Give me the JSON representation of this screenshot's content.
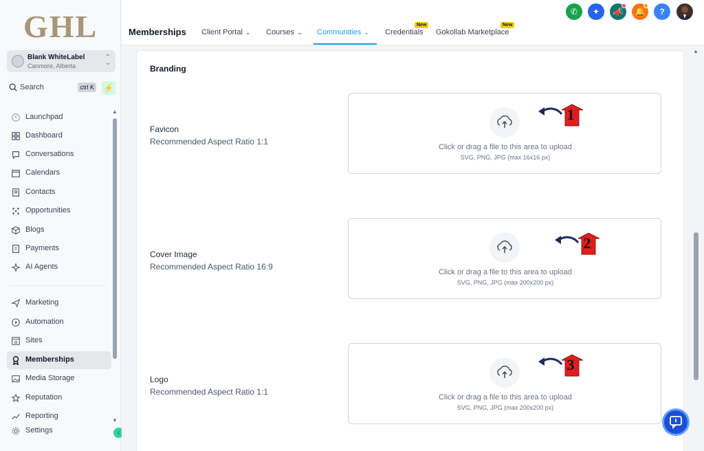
{
  "logo_text": "GHL",
  "account": {
    "name": "Blank WhiteLabel",
    "location": "Canmore, Alberta"
  },
  "search": {
    "label": "Search",
    "shortcut": "ctrl K"
  },
  "sidebar": {
    "items": [
      {
        "label": "Launchpad",
        "icon": "rocket-icon"
      },
      {
        "label": "Dashboard",
        "icon": "grid-icon"
      },
      {
        "label": "Conversations",
        "icon": "chat-icon"
      },
      {
        "label": "Calendars",
        "icon": "calendar-icon"
      },
      {
        "label": "Contacts",
        "icon": "contacts-icon"
      },
      {
        "label": "Opportunities",
        "icon": "opportunities-icon"
      },
      {
        "label": "Blogs",
        "icon": "cube-icon"
      },
      {
        "label": "Payments",
        "icon": "receipt-icon"
      },
      {
        "label": "AI Agents",
        "icon": "sparkle-icon"
      },
      {
        "label": "Marketing",
        "icon": "send-icon"
      },
      {
        "label": "Automation",
        "icon": "play-icon"
      },
      {
        "label": "Sites",
        "icon": "sites-icon"
      },
      {
        "label": "Memberships",
        "icon": "award-icon",
        "active": true
      },
      {
        "label": "Media Storage",
        "icon": "image-icon"
      },
      {
        "label": "Reputation",
        "icon": "star-icon"
      },
      {
        "label": "Reporting",
        "icon": "trend-icon"
      },
      {
        "label": "Settings",
        "icon": "gear-icon"
      }
    ]
  },
  "header": {
    "title": "Memberships",
    "tabs": [
      {
        "label": "Client Portal",
        "dropdown": true
      },
      {
        "label": "Courses",
        "dropdown": true
      },
      {
        "label": "Communities",
        "dropdown": true,
        "active": true
      },
      {
        "label": "Credentials",
        "badge": "New"
      },
      {
        "label": "Gokollab Marketplace",
        "badge": "New"
      }
    ]
  },
  "colors": {
    "accent": "#0ea5e9",
    "phone": "#16a34a",
    "magic": "#2563eb",
    "announce": "#0f766e",
    "bell": "#f97316",
    "help": "#3b82f6",
    "annot_red": "#e11d1d",
    "arrow_navy": "#1e2a5e"
  },
  "branding": {
    "heading": "Branding",
    "rows": [
      {
        "title": "Favicon",
        "subtitle": "Recommended Aspect Ratio 1:1",
        "hint": "Click or drag a file to this area to upload",
        "formats": "SVG, PNG, JPG (max 16x16 px)",
        "annotation": "1"
      },
      {
        "title": "Cover Image",
        "subtitle": "Recommended Aspect Ratio 16:9",
        "hint": "Click or drag a file to this area to upload",
        "formats": "SVG, PNG, JPG (max 200x200 px)",
        "annotation": "2"
      },
      {
        "title": "Logo",
        "subtitle": "Recommended Aspect Ratio 1:1",
        "hint": "Click or drag a file to this area to upload",
        "formats": "SVG, PNG, JPG (max 200x200 px)",
        "annotation": "3"
      }
    ]
  }
}
